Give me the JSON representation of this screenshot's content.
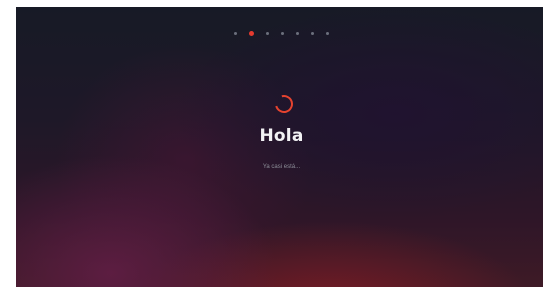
{
  "pager": {
    "dot_count": 7,
    "active_index": 1
  },
  "main": {
    "title": "Hola",
    "status": "Ya casi está..."
  },
  "colors": {
    "accent": "#e53a2f",
    "inactive_dot": "#6b6f7c"
  },
  "icons": {
    "loading": "spinner-icon"
  }
}
